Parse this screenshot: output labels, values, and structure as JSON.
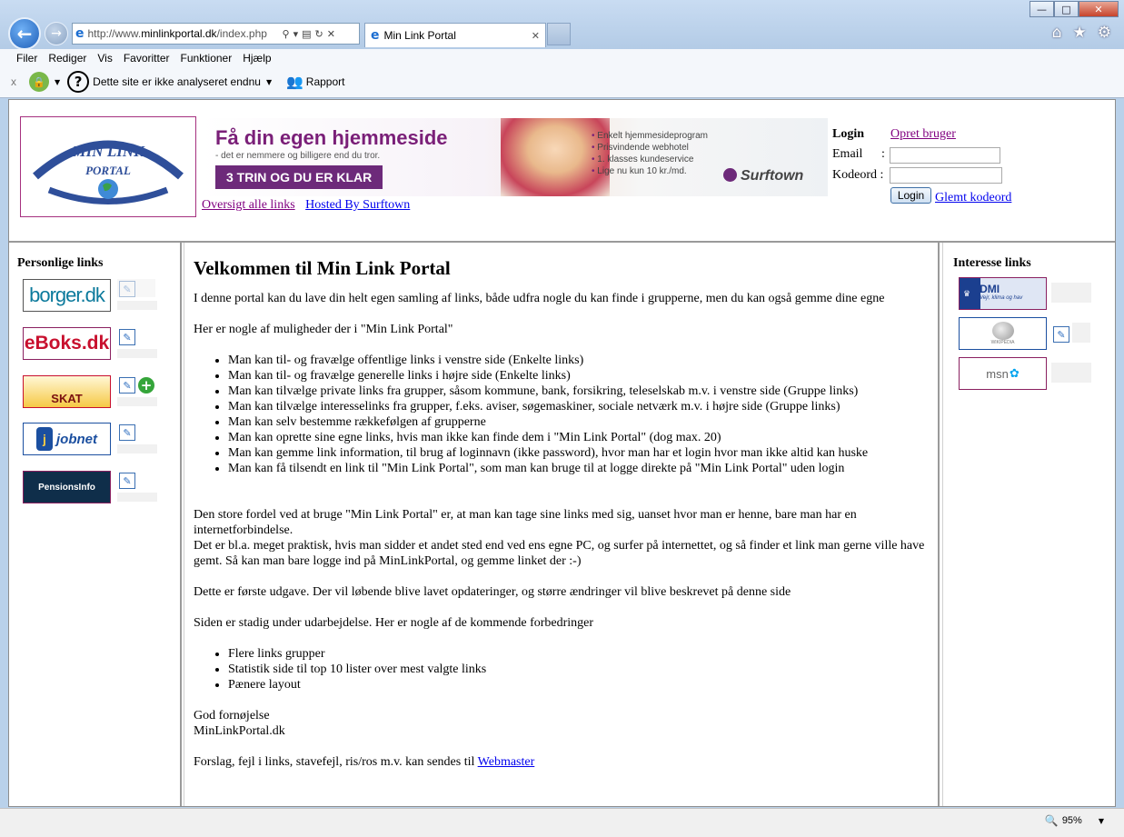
{
  "browser": {
    "address": {
      "prefix": "http://www.",
      "domain": "minlinkportal.dk",
      "path": "/index.php"
    },
    "tab_title": "Min Link Portal",
    "menu": [
      "Filer",
      "Rediger",
      "Vis",
      "Favoritter",
      "Funktioner",
      "Hjælp"
    ],
    "toolbar": {
      "x": "x",
      "site_status": "Dette site er ikke analyseret endnu",
      "report": "Rapport"
    },
    "window_buttons": [
      "minimize",
      "maximize",
      "close"
    ],
    "right_icons": [
      "home-icon",
      "favorites-star-icon",
      "settings-gear-icon"
    ]
  },
  "header": {
    "logo_text": [
      "MIN LINK",
      "PORTAL"
    ],
    "ad": {
      "headline": "Få din egen hjemmeside",
      "sub": "- det er nemmere og billigere end du tror.",
      "cta": "3 TRIN OG DU ER KLAR",
      "bullets": [
        "Enkelt hjemmesideprogram",
        "Prisvindende webhotel",
        "1. klasses kundeservice",
        "Lige nu kun 10 kr./md."
      ],
      "brand": "Surftown"
    },
    "links": {
      "overview": "Oversigt alle links",
      "hosted": "Hosted By Surftown"
    },
    "login": {
      "title": "Login",
      "create": "Opret bruger",
      "email_label": "Email",
      "email_colon": ":",
      "password_label": "Kodeord :",
      "button": "Login",
      "forgot": "Glemt kodeord"
    }
  },
  "left": {
    "title": "Personlige links",
    "items": [
      {
        "label": "borger.dk",
        "color": "#0c7a9c"
      },
      {
        "label": "eBoks.dk",
        "color": "#c8102e"
      },
      {
        "label": "SKAT",
        "color": "#f6c945"
      },
      {
        "label": "jobnet",
        "color": "#1b4fa0"
      },
      {
        "label": "PensionsInfo",
        "color": "#0f2e4a"
      }
    ]
  },
  "main": {
    "title": "Velkommen til Min Link Portal",
    "intro": "I denne portal kan du lave din helt egen samling af links, både udfra nogle du kan finde i grupperne, men du kan også gemme dine egne",
    "possibilities_intro": "Her er nogle af muligheder der i \"Min Link Portal\"",
    "features": [
      "Man kan til- og fravælge offentlige links i venstre side (Enkelte links)",
      "Man kan til- og fravælge generelle links i højre side (Enkelte links)",
      "Man kan tilvælge private links fra grupper, såsom kommune, bank, forsikring, teleselskab m.v. i venstre side (Gruppe links)",
      "Man kan tilvælge interesselinks fra grupper, f.eks. aviser, søgemaskiner, sociale netværk m.v. i højre side (Gruppe links)",
      "Man kan selv bestemme rækkefølgen af grupperne",
      "Man kan oprette sine egne links, hvis man ikke kan finde dem i \"Min Link Portal\" (dog max. 20)",
      "Man kan gemme link information, til brug af loginnavn (ikke password), hvor man har et login hvor man ikke altid kan huske",
      "Man kan få tilsendt en link til \"Min Link Portal\", som man kan bruge til at logge direkte på \"Min Link Portal\" uden login"
    ],
    "advantage": "Den store fordel ved at bruge \"Min Link Portal\" er, at man kan tage sine links med sig, uanset hvor man er henne, bare man har en internetforbindelse.",
    "practical": "Det er bl.a. meget praktisk, hvis man sidder et andet sted end ved ens egne PC, og surfer på internettet, og så finder et link man gerne ville have gemt. Så kan man bare logge ind på MinLinkPortal, og gemme linket der :-)",
    "first_version": "Dette er første udgave. Der vil løbende blive lavet opdateringer, og større ændringer vil blive beskrevet på denne side",
    "under_construction": "Siden er stadig under udarbejdelse. Her er nogle af de kommende forbedringer",
    "upcoming": [
      "Flere links grupper",
      "Statistik side til top 10 lister over mest valgte links",
      "Pænere layout"
    ],
    "enjoy": "God fornøjelse",
    "signature": "MinLinkPortal.dk",
    "feedback": "Forslag, fejl i links, stavefejl, ris/ros m.v. kan sendes til",
    "webmaster": "Webmaster"
  },
  "right": {
    "title": "Interesse links",
    "items": [
      {
        "label": "DMI",
        "sub": "Vejr, klima og hav",
        "color": "#1b3f8f"
      },
      {
        "label": "WIKIPEDIA",
        "color": "#777777"
      },
      {
        "label": "msn",
        "color": "#00a4ef"
      }
    ]
  },
  "status": {
    "zoom": "95%"
  }
}
